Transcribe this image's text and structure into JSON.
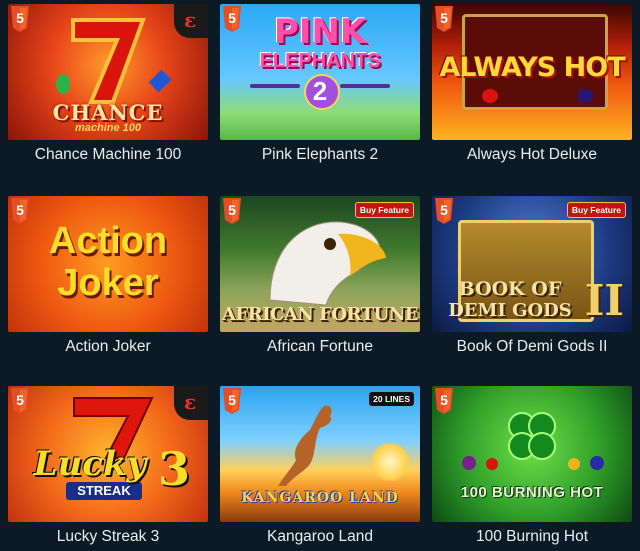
{
  "games": [
    {
      "name": "Chance Machine 100",
      "art_title": "CHANCE",
      "art_subtitle": "machine 100"
    },
    {
      "name": "Pink Elephants 2",
      "art_title": "PINK",
      "art_subtitle": "ELEPHANTS",
      "art_number": "2"
    },
    {
      "name": "Always Hot Deluxe",
      "art_title": "ALWAYS HOT"
    },
    {
      "name": "Action Joker",
      "art_title": "Action",
      "art_subtitle": "Joker"
    },
    {
      "name": "African Fortune",
      "art_title": "AFRICAN FORTUNE",
      "badge": "Buy Feature"
    },
    {
      "name": "Book Of Demi Gods II",
      "art_title": "BOOK OF",
      "art_subtitle": "DEMI GODS",
      "art_number": "II",
      "badge": "Buy Feature"
    },
    {
      "name": "Lucky Streak 3",
      "art_title": "Lucky",
      "art_subtitle": "STREAK",
      "art_number": "3"
    },
    {
      "name": "Kangaroo Land",
      "art_title": "KANGAROO LAND",
      "badge": "20 LINES"
    },
    {
      "name": "100 Burning Hot",
      "art_title": "100 BURNING HOT"
    }
  ],
  "html5_badge_label": "5",
  "provider_logo_letter": "ε",
  "icons": [
    "html5-icon",
    "provider-logo-icon"
  ]
}
